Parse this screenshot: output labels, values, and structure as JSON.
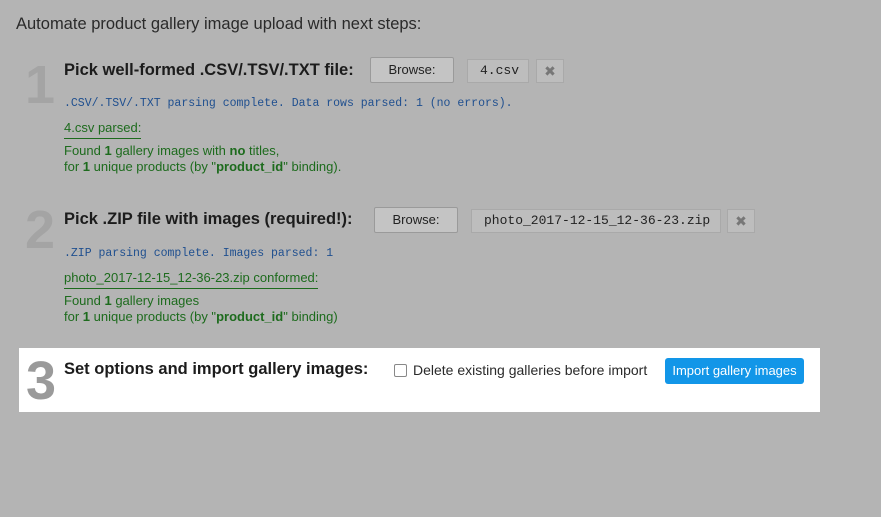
{
  "intro": "Automate product gallery image upload with next steps:",
  "step1": {
    "number": "1",
    "title": "Pick well-formed .CSV/.TSV/.TXT file:",
    "browse_label": "Browse:",
    "file_name": "4.csv",
    "clear_symbol": "✖",
    "parse_message": ".CSV/.TSV/.TXT parsing complete. Data rows parsed: 1 (no errors).",
    "parsed_heading": "4.csv parsed:",
    "line1": {
      "a": "Found ",
      "b": "1",
      "c": " gallery images with ",
      "d": "no",
      "e": " titles,"
    },
    "line2": {
      "a": "for ",
      "b": "1",
      "c": " unique products (by \"",
      "d": "product_id",
      "e": "\" binding)."
    }
  },
  "step2": {
    "number": "2",
    "title": "Pick .ZIP file with images (required!):",
    "browse_label": "Browse:",
    "file_name": "photo_2017-12-15_12-36-23.zip",
    "clear_symbol": "✖",
    "parse_message": ".ZIP parsing complete. Images parsed: 1",
    "parsed_heading": "photo_2017-12-15_12-36-23.zip conformed:",
    "line1": {
      "a": "Found ",
      "b": "1",
      "c": " gallery images"
    },
    "line2": {
      "a": "for ",
      "b": "1",
      "c": " unique products (by \"",
      "d": "product_id",
      "e": "\" binding)"
    }
  },
  "step3": {
    "number": "3",
    "title": "Set options and import gallery images:",
    "checkbox_label": "Delete existing galleries before import",
    "checkbox_checked": false,
    "import_label": "Import gallery images"
  },
  "colors": {
    "background": "#b4b4b4",
    "accent": "#1296e8",
    "success": "#1d6b1d",
    "info": "#1f4f8f"
  }
}
